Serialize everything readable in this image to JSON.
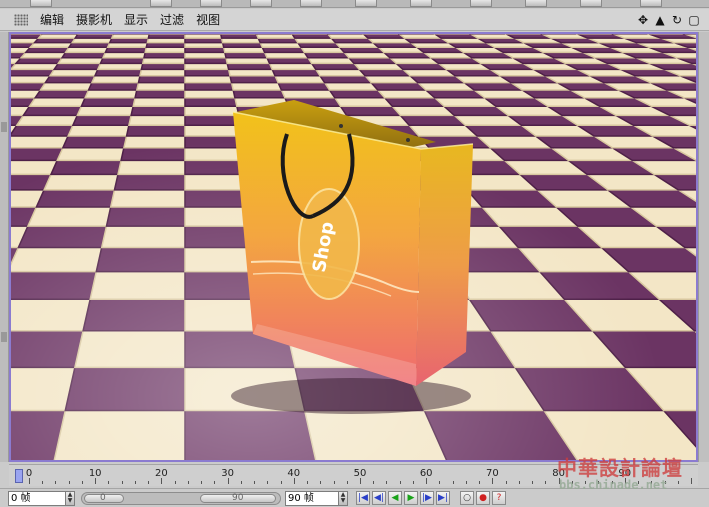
{
  "menu": {
    "items": [
      "编辑",
      "摄影机",
      "显示",
      "过滤",
      "视图"
    ],
    "right_icons": [
      "move-icon",
      "triangle-icon",
      "rotate-icon",
      "maximize-icon"
    ]
  },
  "timeline": {
    "ticks": [
      "0",
      "10",
      "20",
      "30",
      "40",
      "50",
      "60",
      "70",
      "80",
      "90"
    ],
    "current_frame": 0
  },
  "controls": {
    "start_field": "0 帧",
    "slider_start": "0",
    "slider_end": "90",
    "end_field": "90 帧",
    "playback_icons": [
      "go-start-icon",
      "step-back-icon",
      "play-back-icon",
      "play-forward-icon",
      "step-forward-icon",
      "go-end-icon"
    ]
  },
  "scene": {
    "bag_label": "Shop",
    "colors": {
      "tile_light": "#f3e6c6",
      "tile_dark": "#6b3463",
      "bag_top": "#f0c020",
      "bag_bottom": "#f06a6a"
    }
  },
  "watermark": {
    "title": "中華設計論壇",
    "url": "bbs.chinade.net"
  }
}
